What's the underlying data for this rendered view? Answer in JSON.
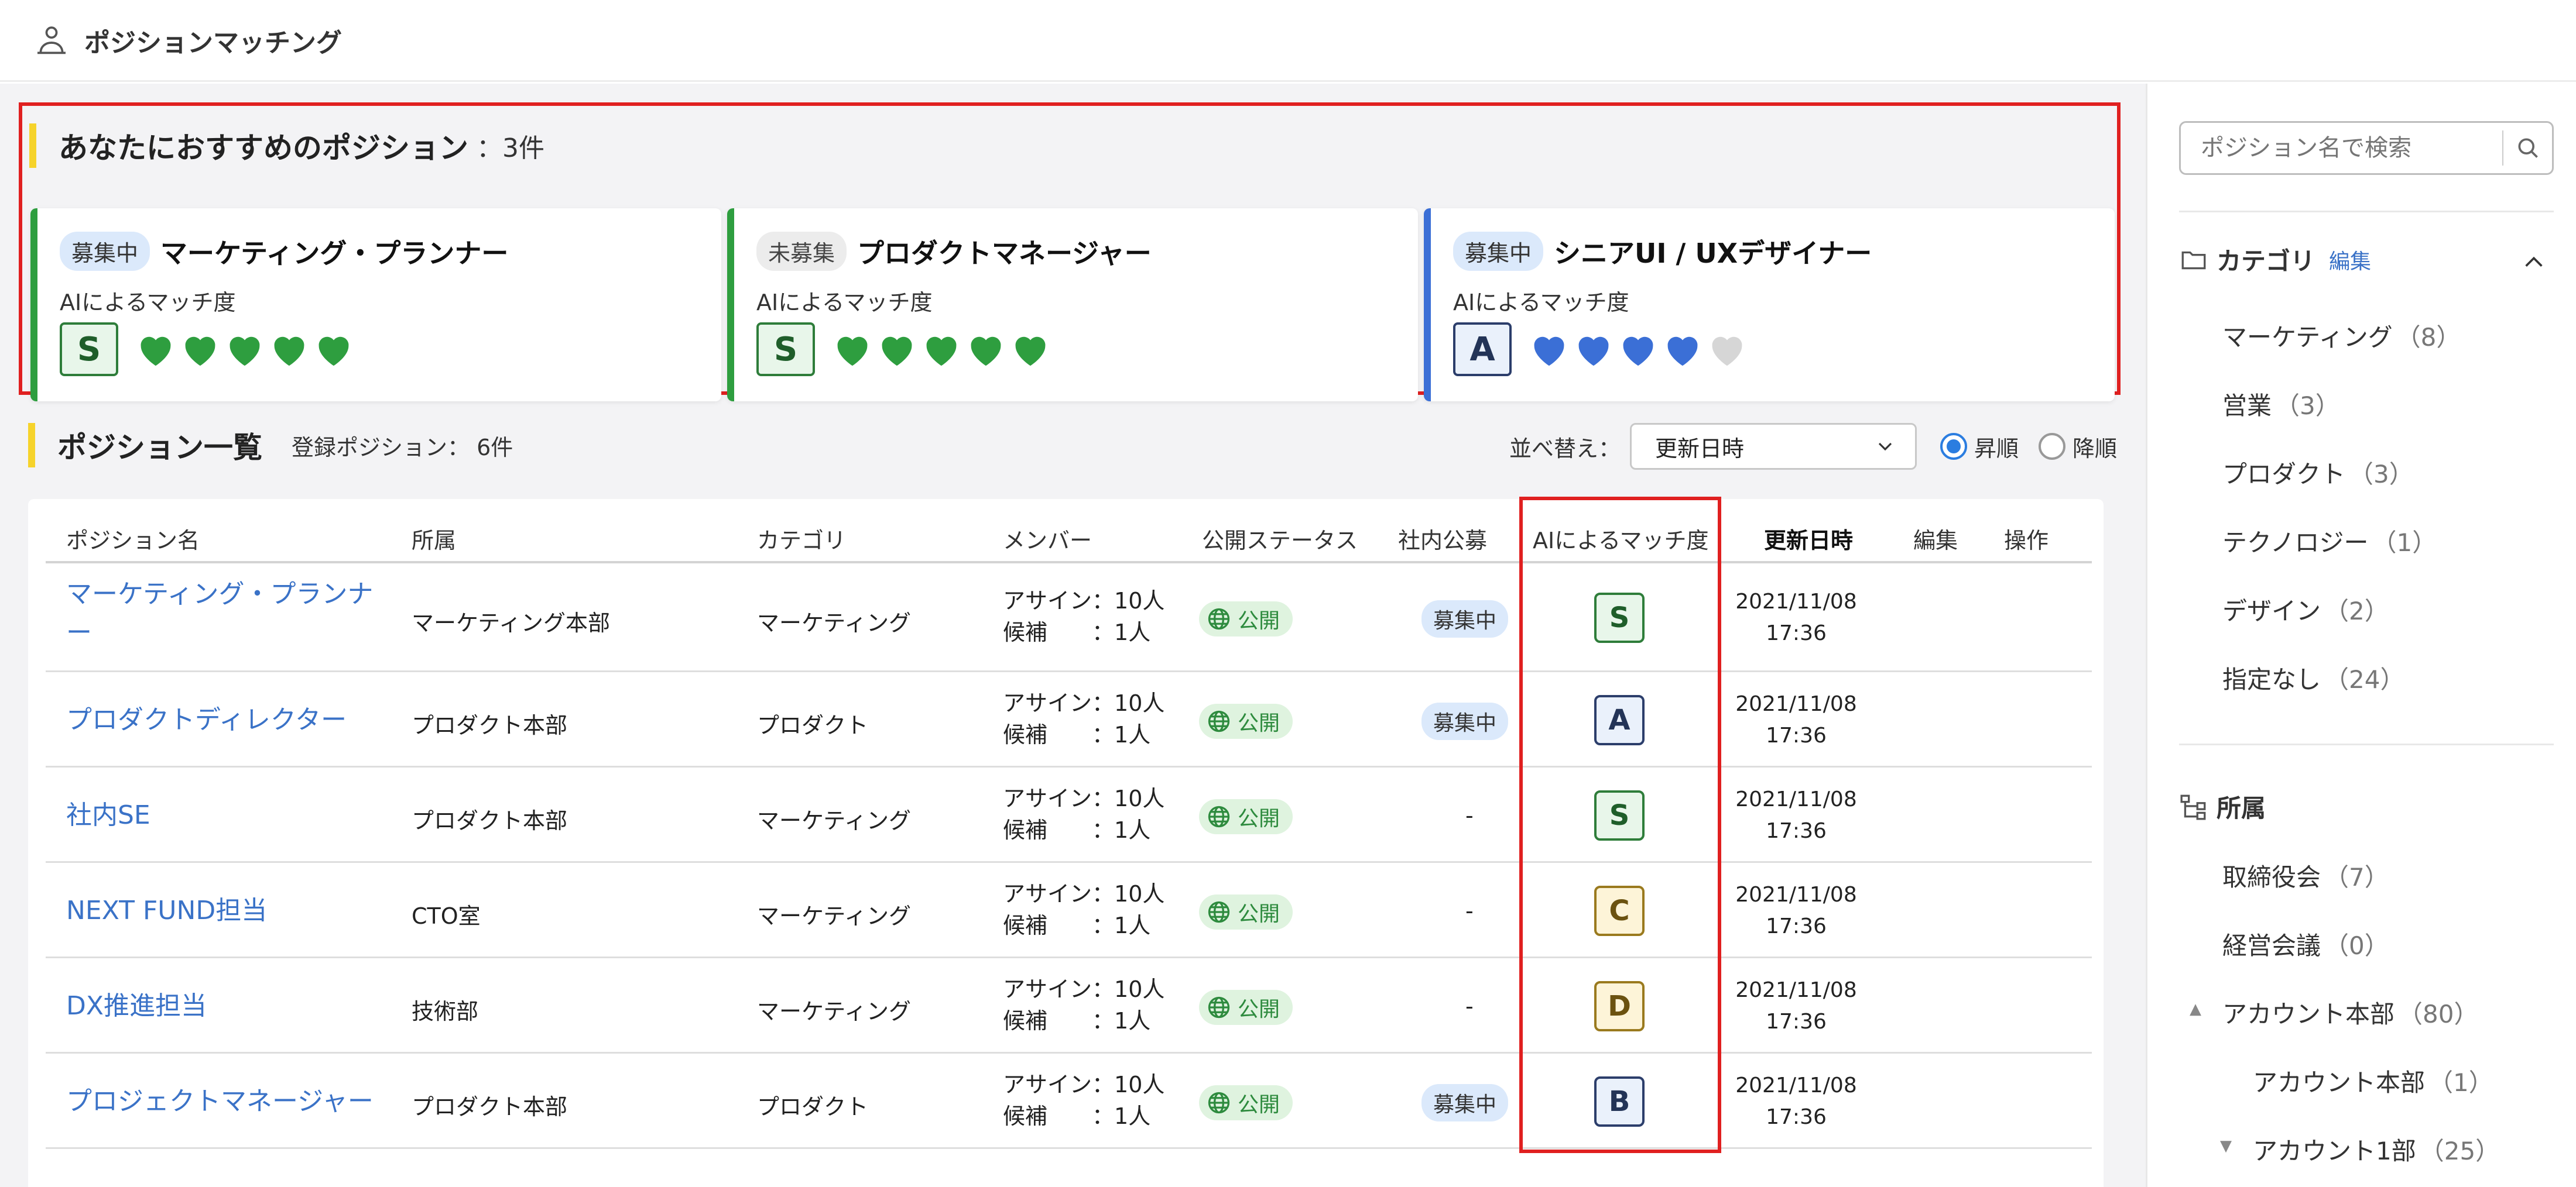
{
  "app": {
    "title": "ポジションマッチング"
  },
  "recommend": {
    "title": "あなたにおすすめのポジション",
    "count": "：3件",
    "match_label": "AIによるマッチ度",
    "cards": [
      {
        "status": "募集中",
        "title": "マーケティング・プランナー",
        "grade": "S",
        "hearts_filled": 5,
        "hearts_total": 5,
        "accent": "#2e9e3f"
      },
      {
        "status": "未募集",
        "title": "プロダクトマネージャー",
        "grade": "S",
        "hearts_filled": 5,
        "hearts_total": 5,
        "accent": "#2e9e3f"
      },
      {
        "status": "募集中",
        "title": "シニアUI / UXデザイナー",
        "grade": "A",
        "hearts_filled": 4,
        "hearts_total": 5,
        "accent": "#3b6fd6"
      }
    ]
  },
  "list": {
    "title": "ポジション一覧",
    "registered": "登録ポジション： 6件",
    "sort_label": "並べ替え：",
    "sort_value": "更新日時",
    "asc_label": "昇順",
    "desc_label": "降順",
    "columns": [
      "ポジション名",
      "所属",
      "カテゴリ",
      "メンバー",
      "公開ステータス",
      "社内公募",
      "AIによるマッチ度",
      "更新日時",
      "編集",
      "操作"
    ],
    "member_assign_label": "アサイン：",
    "member_candidate_label": "候補　　：",
    "public_label": "公開",
    "rows": [
      {
        "name": "マーケティング・プランナー",
        "dept": "マーケティング本部",
        "category": "マーケティング",
        "assign": "10人",
        "candidate": "1人",
        "recruit": "募集中",
        "grade": "S",
        "date": "2021/11/08",
        "time": "17:36"
      },
      {
        "name": "プロダクトディレクター",
        "dept": "プロダクト本部",
        "category": "プロダクト",
        "assign": "10人",
        "candidate": "1人",
        "recruit": "募集中",
        "grade": "A",
        "date": "2021/11/08",
        "time": "17:36"
      },
      {
        "name": "社内SE",
        "dept": "プロダクト本部",
        "category": "マーケティング",
        "assign": "10人",
        "candidate": "1人",
        "recruit": "-",
        "grade": "S",
        "date": "2021/11/08",
        "time": "17:36"
      },
      {
        "name": "NEXT FUND担当",
        "dept": "CTO室",
        "category": "マーケティング",
        "assign": "10人",
        "candidate": "1人",
        "recruit": "-",
        "grade": "C",
        "date": "2021/11/08",
        "time": "17:36"
      },
      {
        "name": "DX推進担当",
        "dept": "技術部",
        "category": "マーケティング",
        "assign": "10人",
        "candidate": "1人",
        "recruit": "-",
        "grade": "D",
        "date": "2021/11/08",
        "time": "17:36"
      },
      {
        "name": "プロジェクトマネージャー",
        "dept": "プロダクト本部",
        "category": "プロダクト",
        "assign": "10人",
        "candidate": "1人",
        "recruit": "募集中",
        "grade": "B",
        "date": "2021/11/08",
        "time": "17:36"
      }
    ]
  },
  "grade_colors": {
    "S": {
      "border": "#2e7d3a",
      "bg": "#e8f6ea",
      "fg": "#1f5e2a"
    },
    "A": {
      "border": "#2c3e6b",
      "bg": "#eaf1fb",
      "fg": "#233457"
    },
    "B": {
      "border": "#2c3e6b",
      "bg": "#eaf1fb",
      "fg": "#233457"
    },
    "C": {
      "border": "#9a7a1e",
      "bg": "#fdf4d8",
      "fg": "#6b5210"
    },
    "D": {
      "border": "#9a7a1e",
      "bg": "#fdf4d8",
      "fg": "#6b5210"
    }
  },
  "sidebar": {
    "search_placeholder": "ポジション名で検索",
    "category_title": "カテゴリ",
    "edit_label": "編集",
    "categories": [
      {
        "label": "マーケティング",
        "count": "（8）"
      },
      {
        "label": "営業",
        "count": "（3）"
      },
      {
        "label": "プロダクト",
        "count": "（3）"
      },
      {
        "label": "テクノロジー",
        "count": "（1）"
      },
      {
        "label": "デザイン",
        "count": "（2）"
      },
      {
        "label": "指定なし",
        "count": "（24）"
      }
    ],
    "dept_title": "所属",
    "depts": [
      {
        "label": "取締役会",
        "count": "（7）",
        "indent": 0,
        "toggle": ""
      },
      {
        "label": "経営会議",
        "count": "（0）",
        "indent": 0,
        "toggle": ""
      },
      {
        "label": "アカウント本部",
        "count": "（80）",
        "indent": 0,
        "toggle": "▲"
      },
      {
        "label": "アカウント本部",
        "count": "（1）",
        "indent": 1,
        "toggle": ""
      },
      {
        "label": "アカウント1部",
        "count": "（25）",
        "indent": 1,
        "toggle": "▼"
      }
    ]
  }
}
